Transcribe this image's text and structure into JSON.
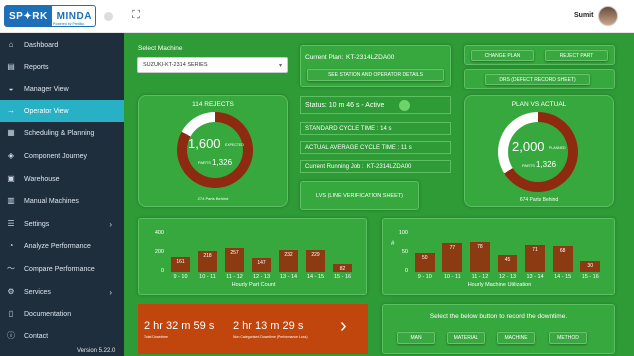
{
  "logo": {
    "part1": "SP✦RK",
    "part2": "MINDA",
    "tagline": "Powered by Prediko"
  },
  "user": {
    "name": "Sumit"
  },
  "sidebar": {
    "items": [
      {
        "label": "Dashboard",
        "icon": "home-icon"
      },
      {
        "label": "Reports",
        "icon": "document-icon"
      },
      {
        "label": "Manager View",
        "icon": "car-icon"
      },
      {
        "label": "Operator View",
        "icon": "arrow-right-icon"
      },
      {
        "label": "Scheduling & Planning",
        "icon": "calendar-icon"
      },
      {
        "label": "Component Journey",
        "icon": "box-icon"
      },
      {
        "label": "Warehouse",
        "icon": "warehouse-icon"
      },
      {
        "label": "Manual Machines",
        "icon": "machine-icon"
      },
      {
        "label": "Settings",
        "icon": "settings-icon"
      },
      {
        "label": "Analyze Performance",
        "icon": "gauge-icon"
      },
      {
        "label": "Compare Performance",
        "icon": "trend-icon"
      },
      {
        "label": "Services",
        "icon": "gear-icon"
      },
      {
        "label": "Documentation",
        "icon": "doc-icon"
      },
      {
        "label": "Contact",
        "icon": "info-icon"
      }
    ],
    "version": "Version 5.22.0"
  },
  "machine": {
    "label": "Select Machine",
    "value": "SUZUKI-KT-2314 SERIES"
  },
  "plan": {
    "label": "Current Plan:",
    "value": "KT-2314LZDA00",
    "see_station": "SEE STATION AND OPERATOR DETAILS"
  },
  "actions": {
    "change_plan": "CHANGE PLAN",
    "reject_part": "REJECT PART",
    "drs": "DRS (DEFECT RECORD SHEET)"
  },
  "rejects": {
    "title": "114 REJECTS",
    "value": "1,600",
    "value_label": "EXPECTED",
    "sub_label": "PARTS",
    "sub_value": "1,326",
    "footer": "274 Parts Behind",
    "fraction": 0.83
  },
  "status": {
    "text": "Status: 10 m 46 s - Active",
    "standard": "STANDARD CYCLE TIME : 14 s",
    "actual": "ACTUAL AVERAGE CYCLE TIME : 11 s",
    "running_label": "Current Running Job :",
    "running_value": "KT-2314LZDA00",
    "lvs": "LVS (LINE VERIFICATION SHEET)"
  },
  "pva": {
    "title": "PLAN VS ACTUAL",
    "value": "2,000",
    "value_label": "PLANNED",
    "sub_label": "PARTS",
    "sub_value": "1,326",
    "footer": "674 Parts Behind",
    "fraction": 0.66
  },
  "colors": {
    "bar": "#8b3a12",
    "ring": "#8e2a10",
    "ring_bg": "#ffffff",
    "green": "#2e9b36",
    "accent": "#28b0c4",
    "downtime": "#c0460d"
  },
  "chart_data": [
    {
      "type": "bar",
      "title": "Hourly Part Count",
      "categories": [
        "9 - 10",
        "10 - 11",
        "11 - 12",
        "12 - 13",
        "13 - 14",
        "14 - 15",
        "15 - 16"
      ],
      "values": [
        161,
        218,
        257,
        147,
        232,
        229,
        82
      ],
      "yticks": [
        0,
        200,
        400
      ],
      "ylim": [
        0,
        400
      ]
    },
    {
      "type": "bar",
      "title": "Hourly Machine Utilization",
      "ylabel": "#",
      "categories": [
        "9 - 10",
        "10 - 11",
        "11 - 12",
        "12 - 13",
        "13 - 14",
        "14 - 15",
        "15 - 16"
      ],
      "values": [
        50,
        77,
        78,
        45,
        71,
        68,
        30
      ],
      "yticks": [
        0,
        50,
        100
      ],
      "ylim": [
        0,
        100
      ]
    }
  ],
  "downtime": {
    "total": "2 hr 32 m 59 s",
    "total_label": "Total Downtime",
    "noncat": "2 hr 13 m 29 s",
    "noncat_label": "Non Categorised Downtime (Performance Loss)",
    "record_text": "Select the below button to record the downtime.",
    "buttons": [
      "MAN",
      "MATERIAL",
      "MACHINE",
      "METHOD"
    ]
  }
}
